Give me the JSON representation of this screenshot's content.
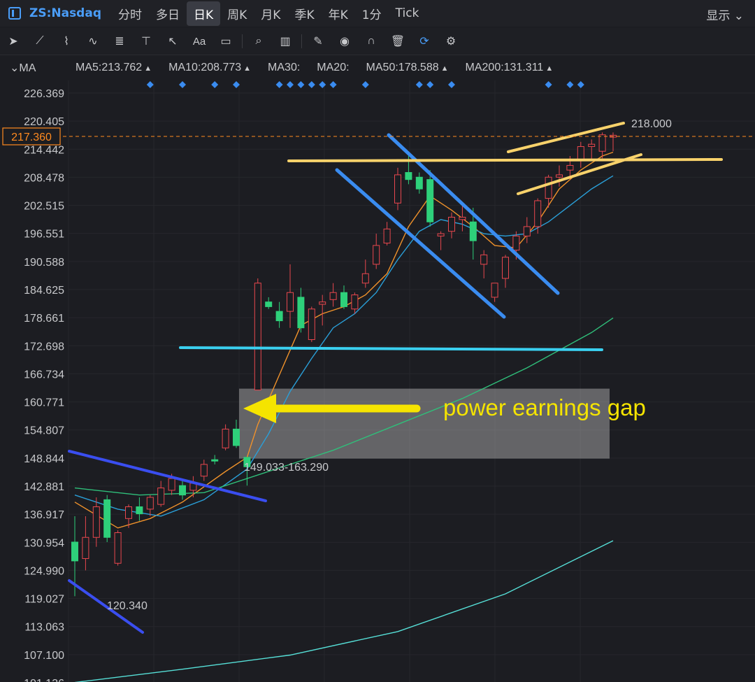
{
  "header": {
    "symbol": "ZS:Nasdaq",
    "timeframes": [
      "分时",
      "多日",
      "日K",
      "周K",
      "月K",
      "季K",
      "年K",
      "1分",
      "Tick"
    ],
    "active_timeframe": "日K",
    "display_label": "显示"
  },
  "toolbar": {
    "icons": [
      "cursor-icon",
      "line-tool-icon",
      "path-tool-icon",
      "wave-tool-icon",
      "fibonacci-icon",
      "vertical-line-icon",
      "arrow-tool-icon",
      "text-tool-icon",
      "comment-icon",
      "search-icon",
      "indicator-icon",
      "pen-icon",
      "eye-icon",
      "magnet-icon",
      "trash-icon",
      "sync-icon",
      "gear-icon"
    ],
    "text_tool_label": "Aa"
  },
  "ma_bar": {
    "selector": "MA",
    "items": [
      {
        "label": "MA5:213.762",
        "color": "#f0922b",
        "up": true
      },
      {
        "label": "MA10:208.773",
        "color": "#3aa7e0",
        "up": true
      },
      {
        "label": "MA30:",
        "color": "#7a5a72",
        "up": false
      },
      {
        "label": "MA20:",
        "color": "#2d4f7a",
        "up": false
      },
      {
        "label": "MA50:178.588",
        "color": "#2fbf7a",
        "up": true
      },
      {
        "label": "MA200:131.311",
        "color": "#e8545c",
        "up": true
      }
    ]
  },
  "colors": {
    "up": "#e8474e",
    "down": "#2ed07a",
    "ma5": "#f0922b",
    "ma10": "#2a9fd8",
    "ma50": "#2fbf7a",
    "ma200": "#56e0d8",
    "event_marker": "#3a8cf0"
  },
  "chart_data": {
    "type": "candlestick",
    "y_ticks": [
      "226.369",
      "220.405",
      "214.442",
      "208.478",
      "202.515",
      "196.551",
      "190.588",
      "184.625",
      "178.661",
      "172.698",
      "166.734",
      "160.771",
      "154.807",
      "148.844",
      "142.881",
      "136.917",
      "130.954",
      "124.990",
      "119.027",
      "113.063",
      "107.100",
      "101.136"
    ],
    "ylim": [
      101.136,
      226.369
    ],
    "current_price": "217.360",
    "candles": [
      {
        "o": 131.0,
        "h": 136.5,
        "l": 119.5,
        "c": 127.0
      },
      {
        "o": 127.5,
        "h": 136.5,
        "l": 125.0,
        "c": 132.0
      },
      {
        "o": 132.0,
        "h": 140.5,
        "l": 130.0,
        "c": 138.5
      },
      {
        "o": 140.0,
        "h": 141.0,
        "l": 131.0,
        "c": 132.0
      },
      {
        "o": 126.5,
        "h": 133.5,
        "l": 126.0,
        "c": 133.0
      },
      {
        "o": 136.0,
        "h": 139.0,
        "l": 134.0,
        "c": 138.5
      },
      {
        "o": 138.5,
        "h": 140.5,
        "l": 135.5,
        "c": 137.0
      },
      {
        "o": 138.0,
        "h": 141.0,
        "l": 136.5,
        "c": 140.5
      },
      {
        "o": 139.0,
        "h": 144.0,
        "l": 138.5,
        "c": 142.5
      },
      {
        "o": 142.0,
        "h": 145.5,
        "l": 141.0,
        "c": 144.5
      },
      {
        "o": 143.0,
        "h": 144.5,
        "l": 140.0,
        "c": 141.0
      },
      {
        "o": 142.0,
        "h": 145.0,
        "l": 140.5,
        "c": 143.5
      },
      {
        "o": 145.0,
        "h": 148.5,
        "l": 144.0,
        "c": 147.5
      },
      {
        "o": 148.5,
        "h": 149.5,
        "l": 147.5,
        "c": 148.2
      },
      {
        "o": 151.0,
        "h": 156.0,
        "l": 150.5,
        "c": 155.0
      },
      {
        "o": 155.0,
        "h": 157.0,
        "l": 151.0,
        "c": 151.5
      },
      {
        "o": 149.0,
        "h": 149.0,
        "l": 143.0,
        "c": 147.0
      },
      {
        "o": 163.3,
        "h": 187.0,
        "l": 163.3,
        "c": 186.0
      },
      {
        "o": 182.0,
        "h": 183.0,
        "l": 180.5,
        "c": 181.0
      },
      {
        "o": 180.0,
        "h": 182.0,
        "l": 176.5,
        "c": 178.0
      },
      {
        "o": 180.0,
        "h": 190.0,
        "l": 176.5,
        "c": 184.0
      },
      {
        "o": 183.0,
        "h": 185.0,
        "l": 175.5,
        "c": 176.5
      },
      {
        "o": 174.0,
        "h": 181.0,
        "l": 173.5,
        "c": 180.5
      },
      {
        "o": 181.5,
        "h": 183.5,
        "l": 177.0,
        "c": 182.0
      },
      {
        "o": 182.5,
        "h": 186.0,
        "l": 181.0,
        "c": 184.0
      },
      {
        "o": 184.0,
        "h": 185.5,
        "l": 180.5,
        "c": 181.0
      },
      {
        "o": 180.5,
        "h": 184.0,
        "l": 179.5,
        "c": 183.5
      },
      {
        "o": 186.0,
        "h": 191.0,
        "l": 185.0,
        "c": 188.0
      },
      {
        "o": 190.0,
        "h": 196.5,
        "l": 189.0,
        "c": 194.0
      },
      {
        "o": 194.5,
        "h": 199.0,
        "l": 194.0,
        "c": 197.5
      },
      {
        "o": 203.0,
        "h": 210.5,
        "l": 201.5,
        "c": 209.0
      },
      {
        "o": 209.5,
        "h": 213.0,
        "l": 207.0,
        "c": 208.0
      },
      {
        "o": 208.5,
        "h": 209.5,
        "l": 205.0,
        "c": 206.0
      },
      {
        "o": 208.0,
        "h": 210.0,
        "l": 198.0,
        "c": 199.0
      },
      {
        "o": 196.0,
        "h": 197.0,
        "l": 193.0,
        "c": 196.5
      },
      {
        "o": 197.0,
        "h": 201.0,
        "l": 195.5,
        "c": 200.0
      },
      {
        "o": 199.5,
        "h": 203.0,
        "l": 197.0,
        "c": 200.0
      },
      {
        "o": 199.0,
        "h": 202.0,
        "l": 191.0,
        "c": 195.0
      },
      {
        "o": 190.0,
        "h": 193.0,
        "l": 187.0,
        "c": 192.0
      },
      {
        "o": 183.0,
        "h": 186.0,
        "l": 182.0,
        "c": 186.0
      },
      {
        "o": 187.0,
        "h": 192.0,
        "l": 185.0,
        "c": 191.5
      },
      {
        "o": 193.0,
        "h": 197.0,
        "l": 191.0,
        "c": 196.0
      },
      {
        "o": 196.0,
        "h": 200.0,
        "l": 194.5,
        "c": 198.0
      },
      {
        "o": 198.0,
        "h": 204.0,
        "l": 196.5,
        "c": 203.5
      },
      {
        "o": 204.0,
        "h": 209.0,
        "l": 202.0,
        "c": 208.5
      },
      {
        "o": 208.5,
        "h": 211.0,
        "l": 206.5,
        "c": 209.0
      },
      {
        "o": 210.0,
        "h": 213.0,
        "l": 208.0,
        "c": 211.0
      },
      {
        "o": 212.0,
        "h": 216.0,
        "l": 210.5,
        "c": 215.0
      },
      {
        "o": 215.0,
        "h": 216.5,
        "l": 212.0,
        "c": 215.5
      },
      {
        "o": 214.0,
        "h": 218.0,
        "l": 212.5,
        "c": 217.5
      },
      {
        "o": 217.0,
        "h": 218.0,
        "l": 214.0,
        "c": 217.4
      }
    ],
    "moving_averages": {
      "MA5": [
        [
          0,
          139.5
        ],
        [
          4,
          134.0
        ],
        [
          7,
          136.0
        ],
        [
          10,
          139.5
        ],
        [
          14,
          146.0
        ],
        [
          16,
          149.0
        ],
        [
          17,
          156.0
        ],
        [
          19,
          166.5
        ],
        [
          21,
          177.0
        ],
        [
          23,
          179.5
        ],
        [
          25,
          181.0
        ],
        [
          27,
          183.5
        ],
        [
          29,
          188.0
        ],
        [
          31,
          198.0
        ],
        [
          33,
          204.5
        ],
        [
          35,
          201.5
        ],
        [
          37,
          198.0
        ],
        [
          39,
          194.0
        ],
        [
          41,
          193.5
        ],
        [
          43,
          199.0
        ],
        [
          45,
          206.0
        ],
        [
          47,
          210.0
        ],
        [
          49,
          213.0
        ],
        [
          50,
          213.8
        ]
      ],
      "MA10": [
        [
          0,
          141.0
        ],
        [
          4,
          138.0
        ],
        [
          8,
          136.5
        ],
        [
          12,
          140.0
        ],
        [
          16,
          146.5
        ],
        [
          18,
          154.0
        ],
        [
          20,
          163.0
        ],
        [
          22,
          170.0
        ],
        [
          24,
          176.5
        ],
        [
          26,
          179.5
        ],
        [
          28,
          184.0
        ],
        [
          30,
          191.0
        ],
        [
          32,
          197.0
        ],
        [
          34,
          199.5
        ],
        [
          36,
          198.5
        ],
        [
          38,
          196.5
        ],
        [
          40,
          196.0
        ],
        [
          42,
          196.5
        ],
        [
          44,
          199.0
        ],
        [
          46,
          202.5
        ],
        [
          48,
          206.0
        ],
        [
          50,
          208.8
        ]
      ],
      "MA50": [
        [
          0,
          142.5
        ],
        [
          6,
          141.0
        ],
        [
          12,
          141.5
        ],
        [
          18,
          146.0
        ],
        [
          24,
          150.5
        ],
        [
          30,
          156.0
        ],
        [
          36,
          161.5
        ],
        [
          42,
          168.0
        ],
        [
          48,
          175.5
        ],
        [
          50,
          178.6
        ]
      ],
      "MA200": [
        [
          0,
          101.2
        ],
        [
          10,
          104.0
        ],
        [
          20,
          107.0
        ],
        [
          30,
          112.0
        ],
        [
          40,
          120.0
        ],
        [
          50,
          131.3
        ]
      ]
    },
    "annotations": {
      "gap_label": "149.033-163.290",
      "low_label": "120.340",
      "target_label": "218.000",
      "gap_note": "power earnings gap"
    },
    "event_marker_candles": [
      7,
      10,
      13,
      15,
      19,
      20,
      21,
      22,
      23,
      24,
      27,
      32,
      33,
      35,
      44,
      46,
      47
    ]
  }
}
